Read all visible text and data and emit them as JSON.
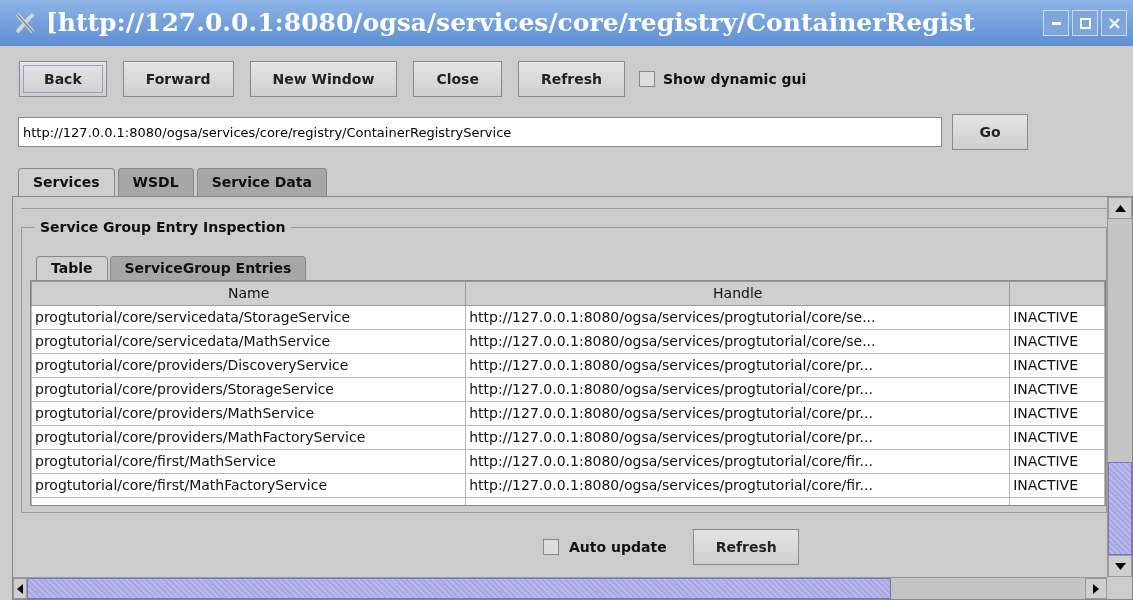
{
  "window": {
    "title": "[http://127.0.0.1:8080/ogsa/services/core/registry/ContainerRegist"
  },
  "toolbar": {
    "buttons": [
      {
        "label": "Back",
        "focused": true
      },
      {
        "label": "Forward",
        "focused": false
      },
      {
        "label": "New Window",
        "focused": false
      },
      {
        "label": "Close",
        "focused": false
      },
      {
        "label": "Refresh",
        "focused": false
      }
    ],
    "show_dynamic_gui": {
      "label": "Show dynamic gui",
      "checked": false
    }
  },
  "address": {
    "value": "http://127.0.0.1:8080/ogsa/services/core/registry/ContainerRegistryService",
    "go_button": "Go"
  },
  "tabs": [
    {
      "label": "Services",
      "selected": true
    },
    {
      "label": "WSDL",
      "selected": false
    },
    {
      "label": "Service Data",
      "selected": false
    }
  ],
  "inspection": {
    "title": "Service Group Entry Inspection",
    "tabs": [
      {
        "label": "Table",
        "selected": true
      },
      {
        "label": "ServiceGroup Entries",
        "selected": false
      }
    ],
    "table": {
      "columns": [
        "Name",
        "Handle"
      ],
      "rows": [
        {
          "name": "progtutorial/core/servicedata/StorageService",
          "handle": "http://127.0.0.1:8080/ogsa/services/progtutorial/core/se...",
          "column_3": "INACTIVE"
        },
        {
          "name": "progtutorial/core/servicedata/MathService",
          "handle": "http://127.0.0.1:8080/ogsa/services/progtutorial/core/se...",
          "column_3": "INACTIVE"
        },
        {
          "name": "progtutorial/core/providers/DiscoveryService",
          "handle": "http://127.0.0.1:8080/ogsa/services/progtutorial/core/pr...",
          "column_3": "INACTIVE"
        },
        {
          "name": "progtutorial/core/providers/StorageService",
          "handle": "http://127.0.0.1:8080/ogsa/services/progtutorial/core/pr...",
          "column_3": "INACTIVE"
        },
        {
          "name": "progtutorial/core/providers/MathService",
          "handle": "http://127.0.0.1:8080/ogsa/services/progtutorial/core/pr...",
          "column_3": "INACTIVE"
        },
        {
          "name": "progtutorial/core/providers/MathFactoryService",
          "handle": "http://127.0.0.1:8080/ogsa/services/progtutorial/core/pr...",
          "column_3": "INACTIVE"
        },
        {
          "name": "progtutorial/core/first/MathService",
          "handle": "http://127.0.0.1:8080/ogsa/services/progtutorial/core/fir...",
          "column_3": "INACTIVE"
        },
        {
          "name": "progtutorial/core/first/MathFactoryService",
          "handle": "http://127.0.0.1:8080/ogsa/services/progtutorial/core/fir...",
          "column_3": "INACTIVE"
        }
      ]
    },
    "auto_update": {
      "label": "Auto update",
      "checked": false
    },
    "refresh_button": "Refresh"
  }
}
